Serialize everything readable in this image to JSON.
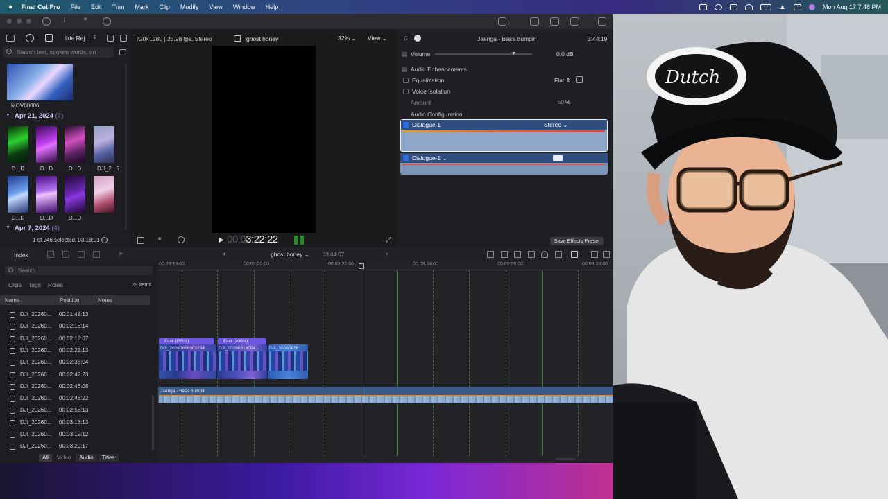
{
  "menubar": {
    "app_name": "Final Cut Pro",
    "items": [
      "File",
      "Edit",
      "Trim",
      "Mark",
      "Clip",
      "Modify",
      "View",
      "Window",
      "Help"
    ],
    "datetime": "Mon Aug 17  7:48 PM"
  },
  "browser": {
    "library_label": "lide Rej...",
    "search_placeholder": "Search text, spoken words, an",
    "top_clip_label": "MOV00006",
    "groups": [
      {
        "date": "Apr 21, 2024",
        "count": "(7)",
        "thumbs": [
          "D...D",
          "D...D",
          "D...D",
          "DJI_2...5",
          "D...D",
          "D...D",
          "D...D"
        ]
      },
      {
        "date": "Apr 7, 2024",
        "count": "(4)"
      }
    ],
    "selection_status": "1 of 246 selected, 03:18:01"
  },
  "viewer": {
    "format": "720×1280 | 23.98 fps, Stereo",
    "clip_name": "ghost honey",
    "zoom": "32%",
    "view_menu": "View",
    "timecode_dim": "00:0",
    "timecode": "3:22:22"
  },
  "inspector": {
    "clip_title": "Jaenga - Bass Bumpin",
    "duration": "3:44:19",
    "volume_label": "Volume",
    "volume_value": "0.0",
    "volume_unit": "dB",
    "enhancements_label": "Audio Enhancements",
    "equalization_label": "Equalization",
    "equalization_value": "Flat",
    "voice_isolation_label": "Voice Isolation",
    "amount_label": "Amount",
    "amount_value": "50",
    "amount_unit": "%",
    "config_label": "Audio Configuration",
    "lane1_label": "Dialogue-1",
    "lane1_channel": "Stereo",
    "lane2_label": "Dialogue-1",
    "save_preset": "Save Effects Preset"
  },
  "index": {
    "tab": "Index",
    "search_placeholder": "Search",
    "tabs": [
      "Clips",
      "Tags",
      "Roles"
    ],
    "item_count": "29 items",
    "columns": [
      "Name",
      "Position",
      "Notes"
    ],
    "rows": [
      {
        "name": "DJI_20260...",
        "position": "00:01:48:13"
      },
      {
        "name": "DJI_20260...",
        "position": "00:02:16:14"
      },
      {
        "name": "DJI_20260...",
        "position": "00:02:18:07"
      },
      {
        "name": "DJI_20260...",
        "position": "00:02:22:13"
      },
      {
        "name": "DJI_20260...",
        "position": "00:02:36:04"
      },
      {
        "name": "DJI_20260...",
        "position": "00:02:42:23"
      },
      {
        "name": "DJI_20260...",
        "position": "00:02:46:08"
      },
      {
        "name": "DJI_20260...",
        "position": "00:02:48:22"
      },
      {
        "name": "DJI_20260...",
        "position": "00:02:56:13"
      },
      {
        "name": "DJI_20260...",
        "position": "00:03:13:13"
      },
      {
        "name": "DJI_20260...",
        "position": "00:03:19:12"
      },
      {
        "name": "DJI_20260...",
        "position": "00:03:20:17"
      }
    ],
    "filters": [
      "All",
      "Video",
      "Audio",
      "Titles"
    ]
  },
  "timeline": {
    "project_name": "ghost honey",
    "duration": "03:44:07",
    "ruler": [
      "00:03:18:00",
      "00:03:20:00",
      "00:03:22:00",
      "00:03:24:00",
      "00:03:26:00",
      "00:03:28:00"
    ],
    "speed_labels": [
      "Fast (195%)",
      "Fast (200%)"
    ],
    "clip_titles": [
      "DJI_20260816003234...",
      "DJI_20260816004...",
      "DJI_20260816..."
    ],
    "audio_clip": "Jaenga - Bass Bumpin"
  }
}
